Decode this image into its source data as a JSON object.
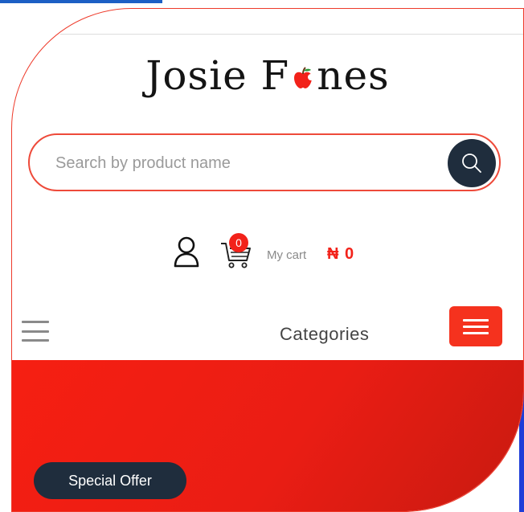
{
  "brand": {
    "logo_text_left": "Josie F",
    "logo_text_right": "nes",
    "logo_color": "#141414",
    "apple_color": "#f2221a"
  },
  "search": {
    "placeholder": "Search by product name",
    "button_icon": "search-icon"
  },
  "account": {
    "user_icon": "user-icon",
    "cart_icon": "cart-icon",
    "cart_count": "0",
    "cart_label": "My cart",
    "cart_total": "₦ 0"
  },
  "nav": {
    "menu_icon": "hamburger-menu-icon",
    "categories_label": "Categories",
    "categories_button_icon": "hamburger-menu-icon"
  },
  "banner": {
    "offer_label": "Special Offer"
  },
  "colors": {
    "accent_red": "#f2221a",
    "dark_navy": "#1f2d3d",
    "border_red": "#ee3a2a",
    "top_blue": "#1d5fc4"
  }
}
